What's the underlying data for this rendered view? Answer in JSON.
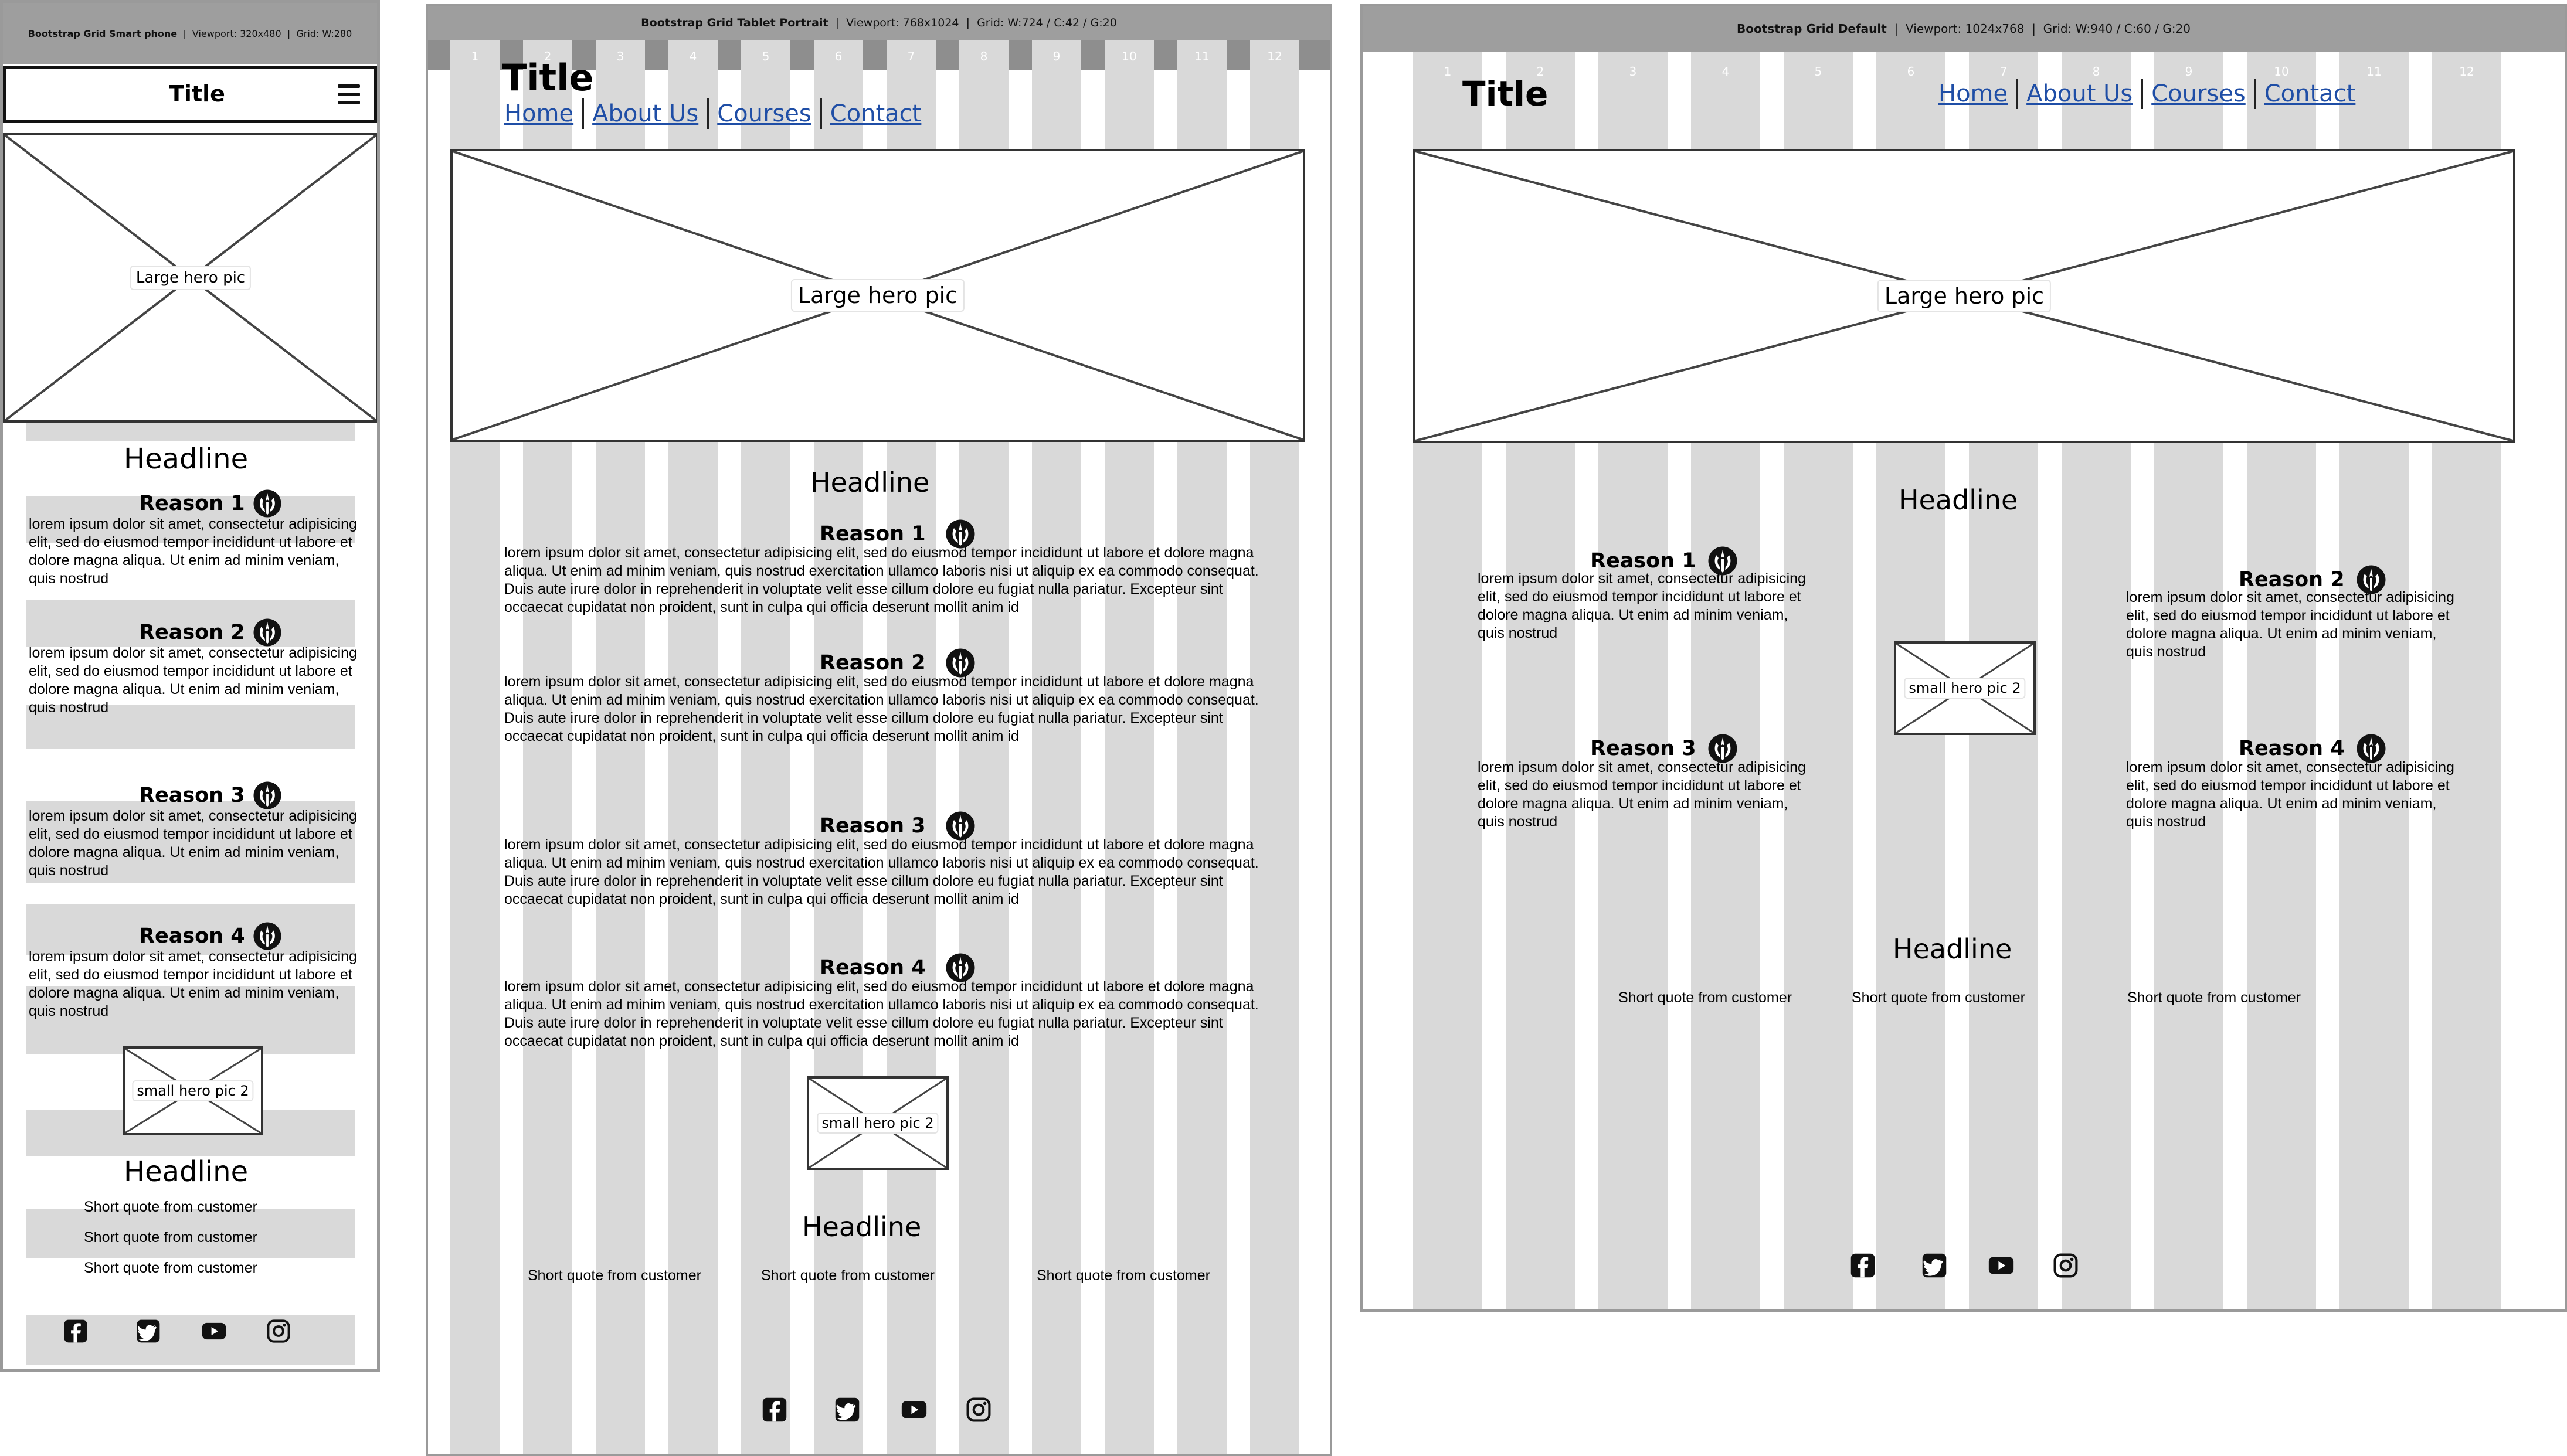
{
  "phone": {
    "bar_name": "Bootstrap Grid Smart phone",
    "bar_viewport": "Viewport: 320x480",
    "bar_grid": "Grid: W:280",
    "title": "Title",
    "hero_label": "Large hero pic",
    "headline_1": "Headline",
    "reasons": [
      {
        "title": "Reason 1",
        "text": "lorem ipsum dolor sit amet, consectetur adipisicing elit, sed do eiusmod tempor incididunt ut labore et dolore magna aliqua. Ut enim ad minim veniam, quis nostrud"
      },
      {
        "title": "Reason 2",
        "text": "lorem ipsum dolor sit amet, consectetur adipisicing elit, sed do eiusmod tempor incididunt ut labore et dolore magna aliqua. Ut enim ad minim veniam, quis nostrud"
      },
      {
        "title": "Reason 3",
        "text": "lorem ipsum dolor sit amet, consectetur adipisicing elit, sed do eiusmod tempor incididunt ut labore et dolore magna aliqua. Ut enim ad minim veniam, quis nostrud"
      },
      {
        "title": "Reason 4",
        "text": "lorem ipsum dolor sit amet, consectetur adipisicing elit, sed do eiusmod tempor incididunt ut labore et dolore magna aliqua. Ut enim ad minim veniam, quis nostrud"
      }
    ],
    "small_hero_label": "small hero pic 2",
    "headline_2": "Headline",
    "quotes": [
      "Short quote from customer",
      "Short quote from customer",
      "Short quote from customer"
    ]
  },
  "tablet": {
    "bar_name": "Bootstrap Grid Tablet Portrait",
    "bar_viewport": "Viewport: 768x1024",
    "bar_grid": "Grid: W:724 / C:42 / G:20",
    "title": "Title",
    "nav": [
      "Home",
      "About Us",
      "Courses",
      "Contact"
    ],
    "hero_label": "Large hero pic",
    "headline_1": "Headline",
    "reasons": [
      {
        "title": "Reason 1",
        "text": "lorem ipsum dolor sit amet, consectetur adipisicing elit, sed do eiusmod tempor incididunt ut labore et dolore magna aliqua. Ut enim ad minim veniam, quis nostrud exercitation ullamco laboris nisi ut aliquip ex ea commodo consequat. Duis aute irure dolor in reprehenderit in voluptate velit esse cillum dolore eu fugiat nulla pariatur. Excepteur sint occaecat cupidatat non proident, sunt in culpa qui officia deserunt mollit anim id"
      },
      {
        "title": "Reason 2",
        "text": "lorem ipsum dolor sit amet, consectetur adipisicing elit, sed do eiusmod tempor incididunt ut labore et dolore magna aliqua. Ut enim ad minim veniam, quis nostrud exercitation ullamco laboris nisi ut aliquip ex ea commodo consequat. Duis aute irure dolor in reprehenderit in voluptate velit esse cillum dolore eu fugiat nulla pariatur. Excepteur sint occaecat cupidatat non proident, sunt in culpa qui officia deserunt mollit anim id"
      },
      {
        "title": "Reason 3",
        "text": "lorem ipsum dolor sit amet, consectetur adipisicing elit, sed do eiusmod tempor incididunt ut labore et dolore magna aliqua. Ut enim ad minim veniam, quis nostrud exercitation ullamco laboris nisi ut aliquip ex ea commodo consequat. Duis aute irure dolor in reprehenderit in voluptate velit esse cillum dolore eu fugiat nulla pariatur. Excepteur sint occaecat cupidatat non proident, sunt in culpa qui officia deserunt mollit anim id"
      },
      {
        "title": "Reason 4",
        "text": "lorem ipsum dolor sit amet, consectetur adipisicing elit, sed do eiusmod tempor incididunt ut labore et dolore magna aliqua. Ut enim ad minim veniam, quis nostrud exercitation ullamco laboris nisi ut aliquip ex ea commodo consequat. Duis aute irure dolor in reprehenderit in voluptate velit esse cillum dolore eu fugiat nulla pariatur. Excepteur sint occaecat cupidatat non proident, sunt in culpa qui officia deserunt mollit anim id"
      }
    ],
    "small_hero_label": "small hero pic 2",
    "headline_2": "Headline",
    "quotes": [
      "Short quote from customer",
      "Short quote from customer",
      "Short quote from customer"
    ]
  },
  "desktop": {
    "bar_name": "Bootstrap Grid Default",
    "bar_viewport": "Viewport: 1024x768",
    "bar_grid": "Grid: W:940 / C:60 / G:20",
    "title": "Title",
    "nav": [
      "Home",
      "About Us",
      "Courses",
      "Contact"
    ],
    "hero_label": "Large hero pic",
    "headline_1": "Headline",
    "reasons": [
      {
        "title": "Reason 1",
        "text": "lorem ipsum dolor sit amet, consectetur adipisicing elit, sed do eiusmod tempor incididunt ut labore et dolore magna aliqua. Ut enim ad minim veniam, quis nostrud"
      },
      {
        "title": "Reason 2",
        "text": "lorem ipsum dolor sit amet, consectetur adipisicing elit, sed do eiusmod tempor incididunt ut labore et dolore magna aliqua. Ut enim ad minim veniam, quis nostrud"
      },
      {
        "title": "Reason 3",
        "text": "lorem ipsum dolor sit amet, consectetur adipisicing elit, sed do eiusmod tempor incididunt ut labore et dolore magna aliqua. Ut enim ad minim veniam, quis nostrud"
      },
      {
        "title": "Reason 4",
        "text": "lorem ipsum dolor sit amet, consectetur adipisicing elit, sed do eiusmod tempor incididunt ut labore et dolore magna aliqua. Ut enim ad minim veniam, quis nostrud"
      }
    ],
    "small_hero_label": "small hero pic 2",
    "headline_2": "Headline",
    "quotes": [
      "Short quote from customer",
      "Short quote from customer",
      "Short quote from customer"
    ]
  },
  "grid_numbers": [
    "1",
    "2",
    "3",
    "4",
    "5",
    "6",
    "7",
    "8",
    "9",
    "10",
    "11",
    "12"
  ],
  "colors": {
    "grid": "#d9d9d9",
    "bar": "#9e9e9e",
    "link": "#1f4ea6"
  },
  "icons": [
    "hamburger-icon",
    "rebel-icon",
    "facebook-icon",
    "twitter-icon",
    "youtube-icon",
    "instagram-icon"
  ]
}
